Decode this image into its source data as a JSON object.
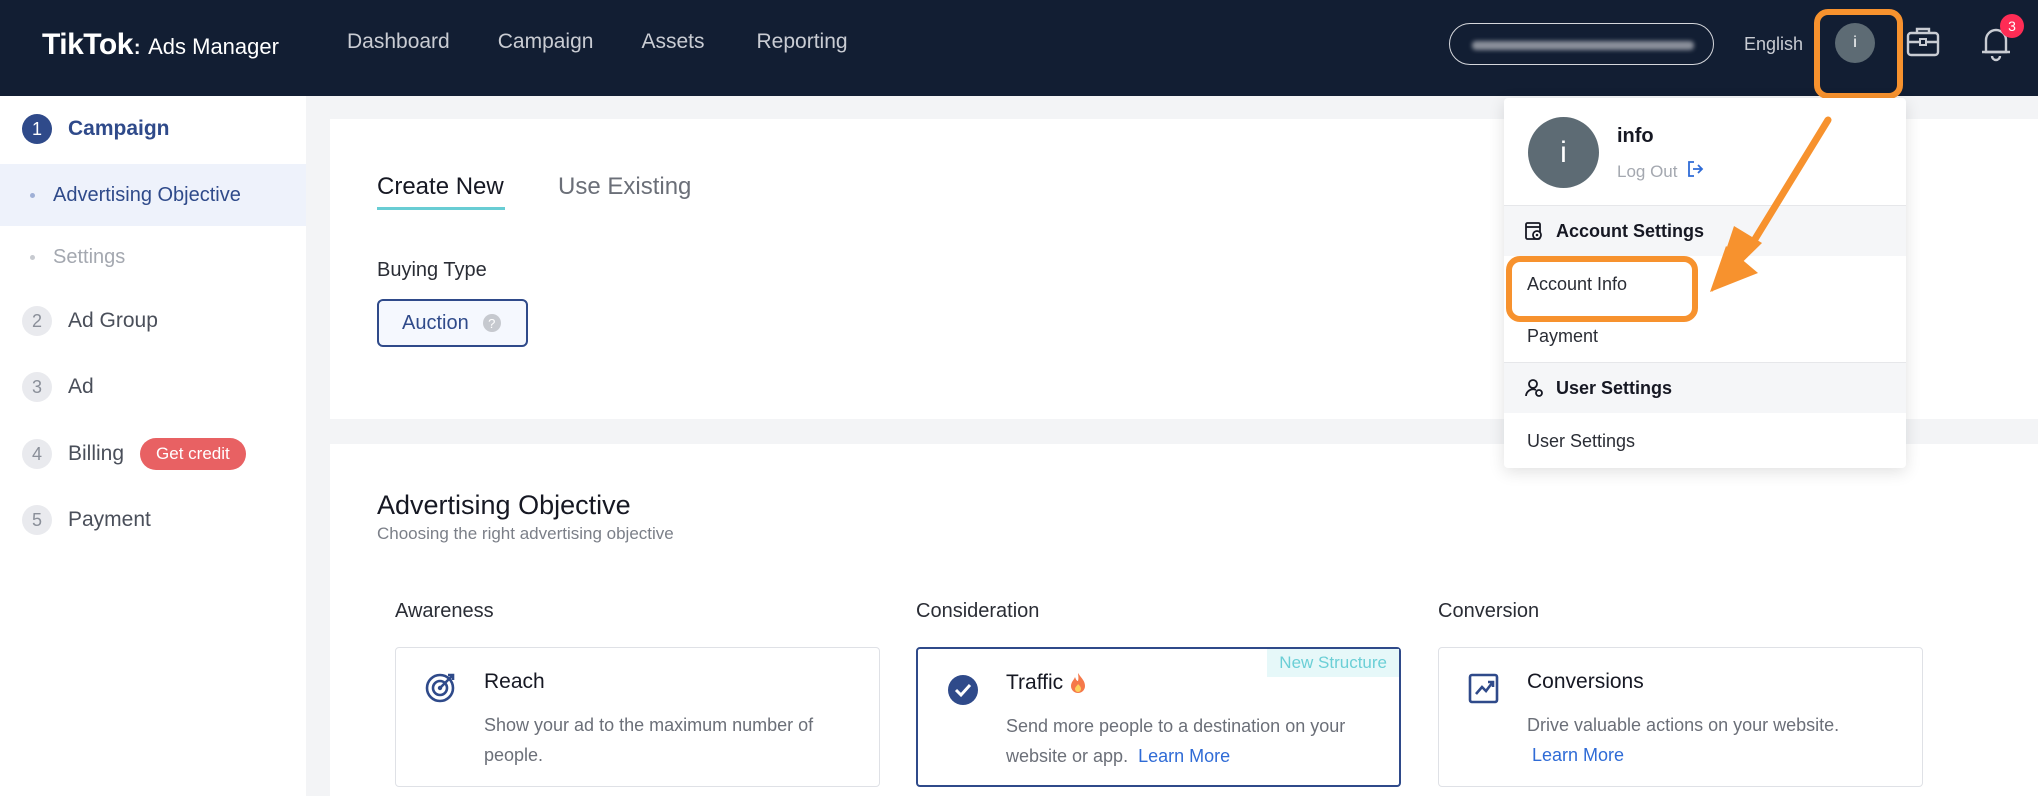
{
  "header": {
    "logo_main": "TikTok",
    "logo_sub": "Ads Manager",
    "nav": [
      "Dashboard",
      "Campaign",
      "Assets",
      "Reporting"
    ],
    "language": "English",
    "avatar_letter": "i",
    "notification_count": "3"
  },
  "sidebar": {
    "steps": [
      {
        "num": "1",
        "label": "Campaign"
      },
      {
        "num": "2",
        "label": "Ad Group"
      },
      {
        "num": "3",
        "label": "Ad"
      },
      {
        "num": "4",
        "label": "Billing"
      },
      {
        "num": "5",
        "label": "Payment"
      }
    ],
    "substeps": [
      "Advertising Objective",
      "Settings"
    ],
    "credit_badge": "Get credit"
  },
  "campaign": {
    "tabs": [
      "Create New",
      "Use Existing"
    ],
    "buying_type_label": "Buying Type",
    "buying_type_value": "Auction"
  },
  "objective": {
    "title": "Advertising Objective",
    "subtitle": "Choosing the right advertising objective",
    "columns": [
      {
        "heading": "Awareness",
        "option": {
          "title": "Reach",
          "desc": "Show your ad to the maximum number of people.",
          "icon": "target-icon"
        }
      },
      {
        "heading": "Consideration",
        "option": {
          "title": "Traffic",
          "desc": "Send more people to a destination on your website or app.",
          "link": "Learn More",
          "tag": "New Structure",
          "icon": "check-circle-icon"
        }
      },
      {
        "heading": "Conversion",
        "option": {
          "title": "Conversions",
          "desc": "Drive valuable actions on your website.",
          "link": "Learn More",
          "icon": "trend-up-icon"
        }
      }
    ]
  },
  "dropdown": {
    "avatar_letter": "i",
    "name": "info",
    "logout": "Log Out",
    "account_settings_header": "Account Settings",
    "account_items": [
      "Account Info",
      "Payment"
    ],
    "user_settings_header": "User Settings",
    "user_items": [
      "User Settings"
    ]
  },
  "colors": {
    "topbar": "#121e33",
    "primary": "#2f4a8a",
    "highlight": "#f7922e",
    "accent_teal": "#68cdd4",
    "credit": "#e86163"
  }
}
